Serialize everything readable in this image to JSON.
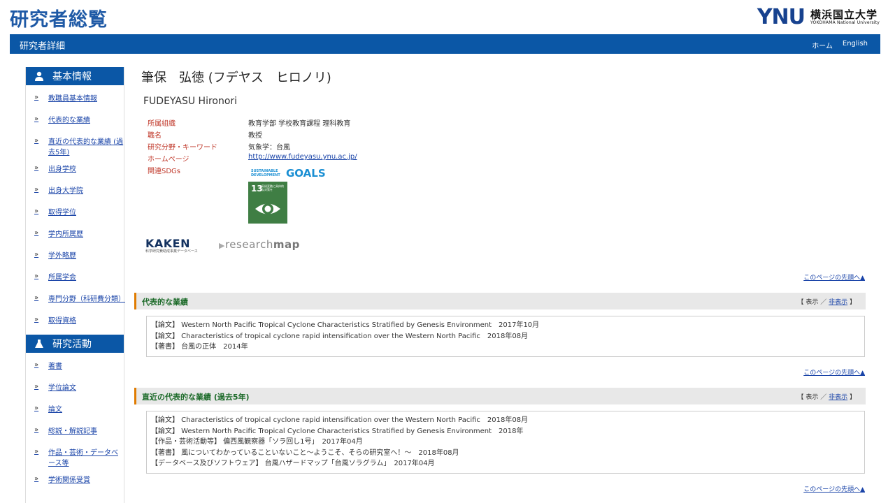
{
  "header": {
    "site_title": "研究者総覧",
    "logo_ynu": "YNU",
    "logo_jp": "横浜国立大学",
    "logo_en": "YOKOHAMA National University"
  },
  "topbar": {
    "heading": "研究者詳細",
    "nav_home": "ホーム",
    "nav_english": "English"
  },
  "sidebar": {
    "section1_title": "基本情報",
    "section1_items": [
      "教職員基本情報",
      "代表的な業績",
      "直近の代表的な業績 (過去5年)",
      "出身学校",
      "出身大学院",
      "取得学位",
      "学内所属歴",
      "学外略歴",
      "所属学会",
      "専門分野（科研費分類）",
      "取得資格"
    ],
    "section2_title": "研究活動",
    "section2_items": [
      "著書",
      "学位論文",
      "論文",
      "総説・解説記事",
      "作品・芸術・データベース等",
      "学術関係受賞"
    ],
    "arrow": "»"
  },
  "profile": {
    "name_jp": "筆保　弘徳 (フデヤス　ヒロノリ)",
    "name_en": "FUDEYASU Hironori",
    "rows": [
      {
        "key": "所属組織",
        "value": "教育学部 学校教育課程 理科教育"
      },
      {
        "key": "職名",
        "value": "教授"
      },
      {
        "key": "研究分野・キーワード",
        "value": "気象学：台風"
      },
      {
        "key": "ホームページ",
        "value": "http://www.fudeyasu.ynu.ac.jp/"
      },
      {
        "key": "関連SDGs",
        "value": ""
      }
    ],
    "sdg_small": "SUSTAINABLE DEVELOPMENT",
    "sdg_big": "GOALS",
    "sdg13_num": "13",
    "sdg13_text": "気候変動に具体的な対策を"
  },
  "external": {
    "kaken": "KAKEN",
    "kaken_sub": "科学研究費助成事業データベース",
    "researchmap_a": "research",
    "researchmap_b": "map"
  },
  "to_top": "このページの先頭へ▲",
  "sections": [
    {
      "title": "代表的な業績",
      "toggle_open": "【 表示 ／ ",
      "toggle_hide": "非表示",
      "toggle_close": " 】",
      "items": [
        "【論文】 Western North Pacific Tropical Cyclone Characteristics Stratified by Genesis Environment　2017年10月",
        "【論文】 Characteristics of tropical cyclone rapid intensification over the Western North Pacific　2018年08月",
        "【著書】 台風の正体　2014年"
      ]
    },
    {
      "title": "直近の代表的な業績 (過去5年)",
      "toggle_open": "【 表示 ／ ",
      "toggle_hide": "非表示",
      "toggle_close": " 】",
      "items": [
        "【論文】 Characteristics of tropical cyclone rapid intensification over the Western North Pacific　2018年08月",
        "【論文】 Western North Pacific Tropical Cyclone Characteristics Stratified by Genesis Environment　2018年",
        "【作品・芸術活動等】 偏西風観察器「ソラ回し1号」　2017年04月",
        "【著書】 風についてわかっていることいないこと～ようこそ、そらの研究室へ！～　2018年08月",
        "【データベース及びソフトウェア】 台風ハザードマップ「台風ソラグラム」　2017年04月"
      ]
    }
  ]
}
